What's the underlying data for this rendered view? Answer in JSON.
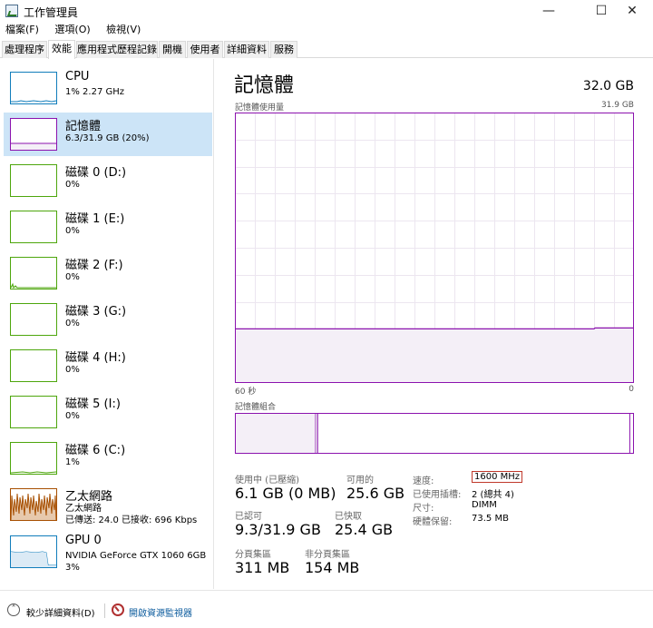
{
  "window": {
    "title": "工作管理員",
    "minimize_glyph": "—",
    "maximize_glyph": "☐",
    "close_glyph": "✕"
  },
  "menu": [
    "檔案(F)",
    "選項(O)",
    "檢視(V)"
  ],
  "tabs": [
    {
      "label": "處理程序",
      "active": false
    },
    {
      "label": "效能",
      "active": true
    },
    {
      "label": "應用程式歷程記錄",
      "active": false
    },
    {
      "label": "開機",
      "active": false
    },
    {
      "label": "使用者",
      "active": false
    },
    {
      "label": "詳細資料",
      "active": false
    },
    {
      "label": "服務",
      "active": false
    }
  ],
  "resources": [
    {
      "title": "CPU",
      "sub": "1% 2.27 GHz",
      "sub2": "",
      "color": "#117dbb",
      "icon": "cpu-graph-thumbnail"
    },
    {
      "title": "記憶體",
      "sub": "6.3/31.9 GB (20%)",
      "sub2": "",
      "color": "#8b12ae",
      "selected": true,
      "level": 0.2,
      "icon": "memory-graph-thumbnail"
    },
    {
      "title": "磁碟 0 (D:)",
      "sub": "0%",
      "sub2": "",
      "color": "#4da60c",
      "icon": "disk-graph-thumbnail"
    },
    {
      "title": "磁碟 1 (E:)",
      "sub": "0%",
      "sub2": "",
      "color": "#4da60c",
      "icon": "disk-graph-thumbnail"
    },
    {
      "title": "磁碟 2 (F:)",
      "sub": "0%",
      "sub2": "",
      "color": "#4da60c",
      "icon": "disk-graph-thumbnail"
    },
    {
      "title": "磁碟 3 (G:)",
      "sub": "0%",
      "sub2": "",
      "color": "#4da60c",
      "icon": "disk-graph-thumbnail"
    },
    {
      "title": "磁碟 4 (H:)",
      "sub": "0%",
      "sub2": "",
      "color": "#4da60c",
      "icon": "disk-graph-thumbnail"
    },
    {
      "title": "磁碟 5 (I:)",
      "sub": "0%",
      "sub2": "",
      "color": "#4da60c",
      "icon": "disk-graph-thumbnail"
    },
    {
      "title": "磁碟 6 (C:)",
      "sub": "1%",
      "sub2": "",
      "color": "#4da60c",
      "icon": "disk-graph-thumbnail"
    },
    {
      "title": "乙太網路",
      "sub": "乙太網路",
      "sub2": "已傳送: 24.0  已接收: 696 Kbps",
      "color": "#a74f01",
      "icon": "network-graph-thumbnail"
    },
    {
      "title": "GPU 0",
      "sub": "NVIDIA GeForce GTX 1060 6GB",
      "sub2": "3%",
      "color": "#117dbb",
      "icon": "gpu-graph-thumbnail"
    }
  ],
  "memory": {
    "title": "記憶體",
    "total": "32.0 GB",
    "usage_label": "記憶體使用量",
    "usage_max": "31.9 GB",
    "usage_level": 0.2,
    "axis_left": "60 秒",
    "axis_right": "0",
    "composition_label": "記憶體組合",
    "composition": {
      "in_use": 0.2,
      "modified": 0.005,
      "standby": 0.78,
      "free": 0.015
    },
    "chart_color": "#8b12ae",
    "fill_color": "#f4eff7",
    "grid_color": "#ece6f0",
    "stats": {
      "in_use_label": "使用中 (已壓縮)",
      "in_use_value": "6.1 GB (0 MB)",
      "available_label": "可用的",
      "available_value": "25.6 GB",
      "committed_label": "已認可",
      "committed_value": "9.3/31.9 GB",
      "cached_label": "已快取",
      "cached_value": "25.4 GB",
      "paged_pool_label": "分頁集區",
      "paged_pool_value": "311 MB",
      "nonpaged_pool_label": "非分頁集區",
      "nonpaged_pool_value": "154 MB"
    },
    "specs": {
      "speed_label": "速度:",
      "speed_value": "1600 MHz",
      "slots_label": "已使用插槽:",
      "slots_value": "2 (總共 4)",
      "form_label": "尺寸:",
      "form_value": "DIMM",
      "reserved_label": "硬體保留:",
      "reserved_value": "73.5 MB"
    }
  },
  "footer": {
    "fewer_details": "較少詳細資料(D)",
    "open_monitor": "開啟資源監視器"
  }
}
